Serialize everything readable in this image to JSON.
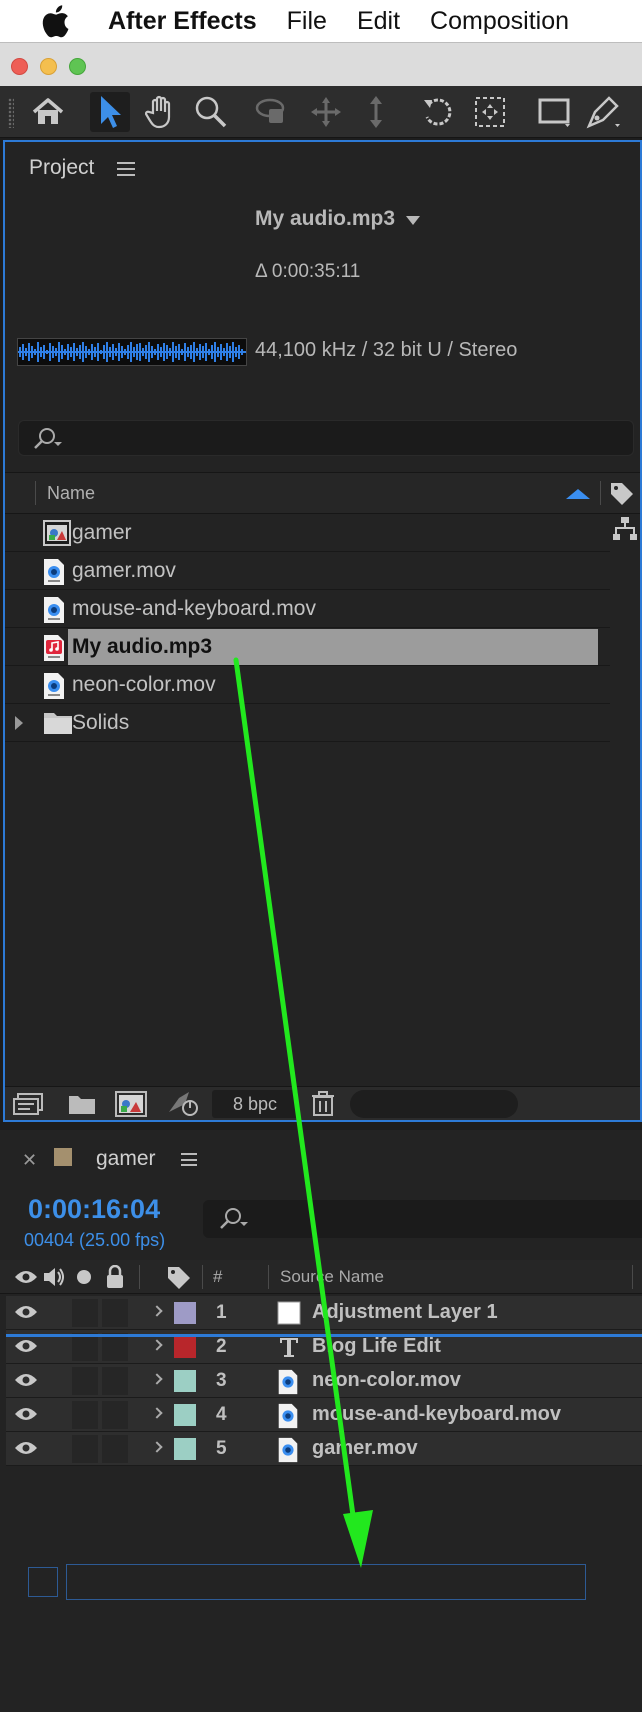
{
  "menubar": {
    "app_name": "After Effects",
    "items": [
      "File",
      "Edit",
      "Composition"
    ]
  },
  "window": {
    "traffic_lights": [
      "close",
      "minimize",
      "zoom"
    ]
  },
  "toolbar": {
    "tools": [
      "home-icon",
      "selection-tool-icon",
      "hand-tool-icon",
      "zoom-tool-icon",
      "orbit-camera-icon",
      "pan-camera-icon",
      "dolly-camera-icon",
      "rotate-tool-icon",
      "pan-behind-icon",
      "rectangle-tool-icon",
      "pen-tool-icon"
    ],
    "active_tool": "selection-tool-icon"
  },
  "project": {
    "title": "Project",
    "selected_item": "My audio.mp3",
    "duration": "Δ 0:00:35:11",
    "audio_info": "44,100 kHz / 32 bit U / Stereo",
    "column_name": "Name",
    "items": [
      {
        "name": "gamer",
        "type": "composition"
      },
      {
        "name": "gamer.mov",
        "type": "movie"
      },
      {
        "name": "mouse-and-keyboard.mov",
        "type": "movie"
      },
      {
        "name": "My audio.mp3",
        "type": "audio",
        "selected": true
      },
      {
        "name": "neon-color.mov",
        "type": "movie"
      },
      {
        "name": "Solids",
        "type": "folder"
      }
    ],
    "bit_depth": "8 bpc"
  },
  "timeline": {
    "comp_name": "gamer",
    "timecode": "0:00:16:04",
    "frames": "00404 (25.00 fps)",
    "col_number": "#",
    "col_source_name": "Source Name",
    "layers": [
      {
        "num": "1",
        "name": "Adjustment Layer 1",
        "label_color": "#9e9bc6",
        "icon": "solid-icon"
      },
      {
        "num": "2",
        "name": "Blog Life Edit",
        "label_color": "#b8262b",
        "icon": "text-icon"
      },
      {
        "num": "3",
        "name": "neon-color.mov",
        "label_color": "#9ccfc4",
        "icon": "footage-icon"
      },
      {
        "num": "4",
        "name": "mouse-and-keyboard.mov",
        "label_color": "#9ccfc4",
        "icon": "footage-icon"
      },
      {
        "num": "5",
        "name": "gamer.mov",
        "label_color": "#9ccfc4",
        "icon": "footage-icon"
      }
    ]
  },
  "colors": {
    "accent_blue": "#2d7ad6",
    "drag_arrow": "#22e81e",
    "selection_gray": "#9c9c9c"
  }
}
